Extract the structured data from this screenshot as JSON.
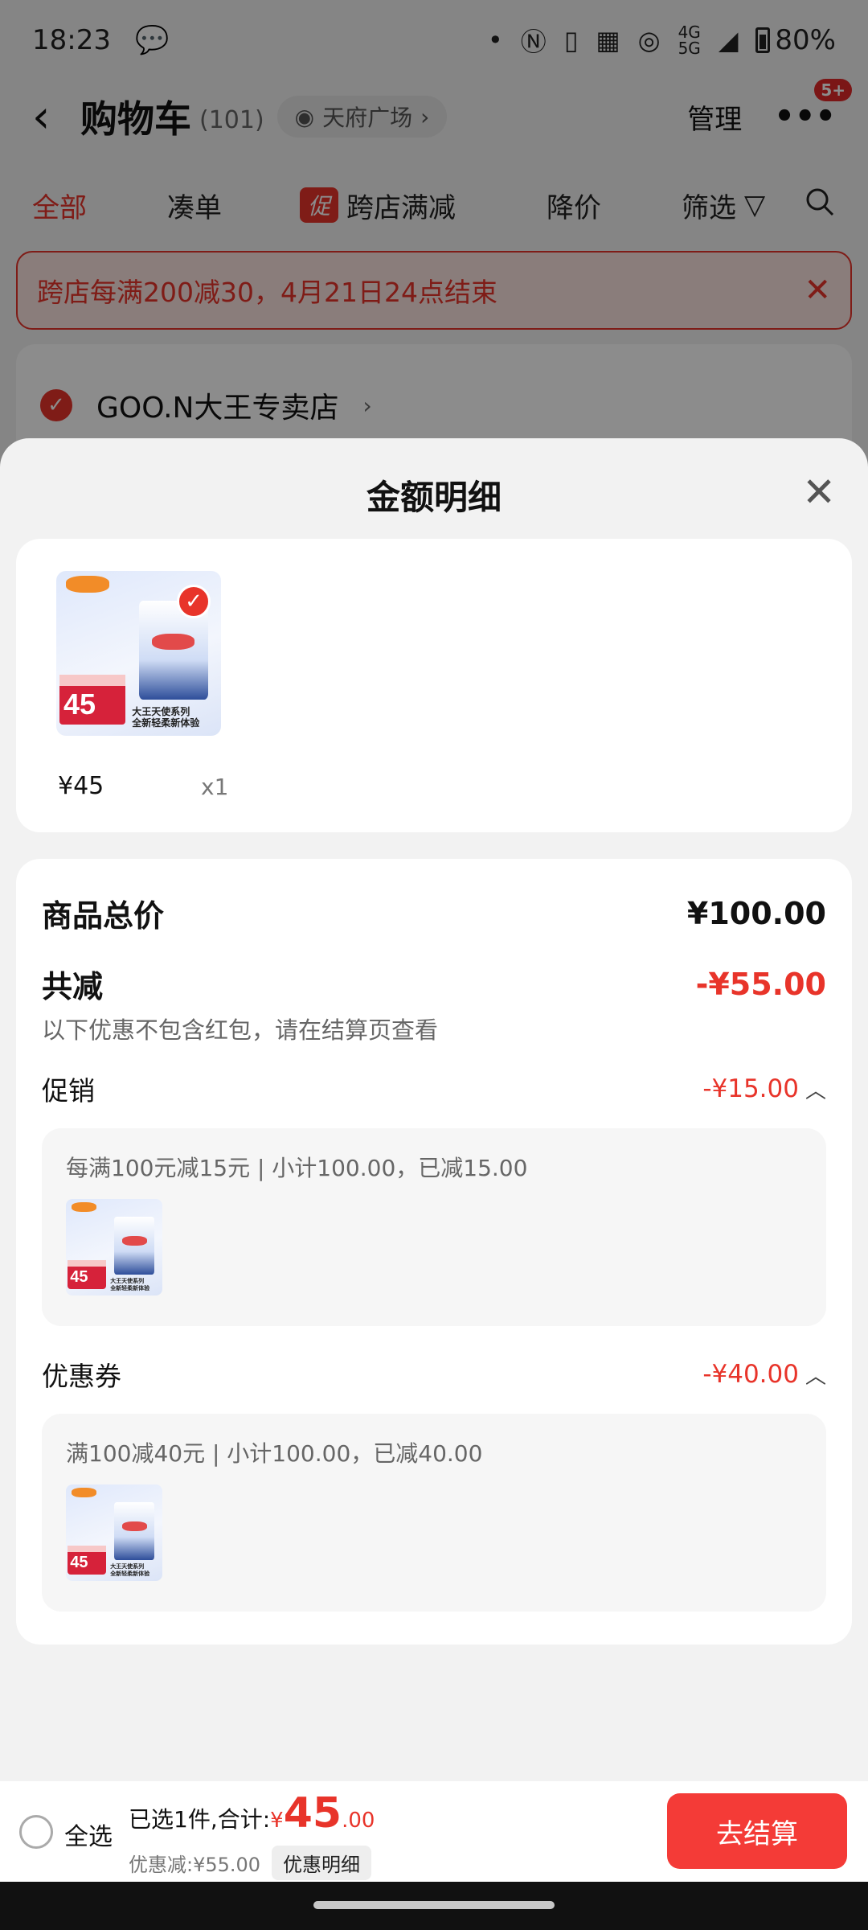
{
  "status_bar": {
    "time": "18:23",
    "network": "4G\n5G",
    "battery": "80%"
  },
  "header": {
    "title": "购物车",
    "count": "(101)",
    "location": "天府广场",
    "manage": "管理",
    "badge": "5+"
  },
  "tabs": [
    {
      "label": "全部",
      "active": true
    },
    {
      "label": "凑单"
    },
    {
      "label": "跨店满减",
      "tag": "促"
    },
    {
      "label": "降价"
    },
    {
      "label": "筛选"
    }
  ],
  "promo_banner": {
    "text": "跨店每满200减30，4月21日24点结束"
  },
  "store": {
    "name": "GOO.N大王专卖店"
  },
  "sheet": {
    "title": "金额明细",
    "product": {
      "price": "¥45",
      "qty": "x1",
      "thumb_price": "45",
      "thumb_caption_1": "大王天使系列",
      "thumb_caption_2": "全新轻柔新体验"
    },
    "total": {
      "label": "商品总价",
      "value": "¥100.00"
    },
    "reduce": {
      "label": "共减",
      "value": "-¥55.00",
      "note": "以下优惠不包含红包，请在结算页查看"
    },
    "promotion": {
      "label": "促销",
      "value": "-¥15.00",
      "detail": "每满100元减15元 | 小计100.00，已减15.00"
    },
    "coupon": {
      "label": "优惠券",
      "value": "-¥40.00",
      "detail": "满100减40元 | 小计100.00，已减40.00"
    }
  },
  "bottom_bar": {
    "select_all": "全选",
    "summary": "已选1件,合计:",
    "currency": "¥",
    "total_int": "45",
    "total_dec": ".00",
    "discount": "优惠减:¥55.00",
    "detail_chip": "优惠明细",
    "checkout": "去结算"
  },
  "colors": {
    "accent": "#e8342a",
    "checkout": "#f43b37",
    "overlay": "rgba(0,0,0,0.45)"
  }
}
